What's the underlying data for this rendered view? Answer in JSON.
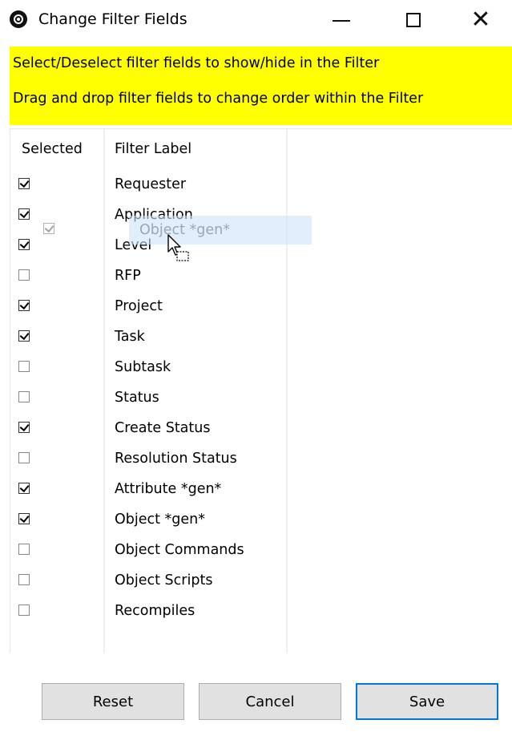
{
  "window": {
    "title": "Change Filter Fields",
    "icon": "app-logo-icon",
    "controls": {
      "minimize": "minimize-icon",
      "maximize": "maximize-icon",
      "close": "close-icon",
      "close_glyph": "✕"
    }
  },
  "instructions": {
    "line1": "Select/Deselect filter fields to show/hide in the Filter",
    "line2": "Drag and drop filter fields to change order within the Filter",
    "background_color": "#ffff00"
  },
  "table": {
    "headers": {
      "selected": "Selected",
      "label": "Filter Label"
    },
    "rows": [
      {
        "label": "Requester",
        "checked": true
      },
      {
        "label": "Application",
        "checked": true,
        "highlighted": true
      },
      {
        "label": "Level",
        "checked": true
      },
      {
        "label": "RFP",
        "checked": false
      },
      {
        "label": "Project",
        "checked": true
      },
      {
        "label": "Task",
        "checked": true
      },
      {
        "label": "Subtask",
        "checked": false
      },
      {
        "label": "Status",
        "checked": false
      },
      {
        "label": "Create Status",
        "checked": true
      },
      {
        "label": "Resolution Status",
        "checked": false
      },
      {
        "label": "Attribute *gen*",
        "checked": true
      },
      {
        "label": "Object *gen*",
        "checked": true,
        "selected": true
      },
      {
        "label": "Object Commands",
        "checked": false
      },
      {
        "label": "Object Scripts",
        "checked": false
      },
      {
        "label": "Recompiles",
        "checked": false
      }
    ]
  },
  "drag_ghost": {
    "label": "Object *gen*",
    "checked": true,
    "cursor": "drag-copy-cursor-icon"
  },
  "buttons": {
    "reset": "Reset",
    "cancel": "Cancel",
    "save": "Save"
  },
  "colors": {
    "selection": "#cce4f7",
    "accent": "#0078d7"
  }
}
